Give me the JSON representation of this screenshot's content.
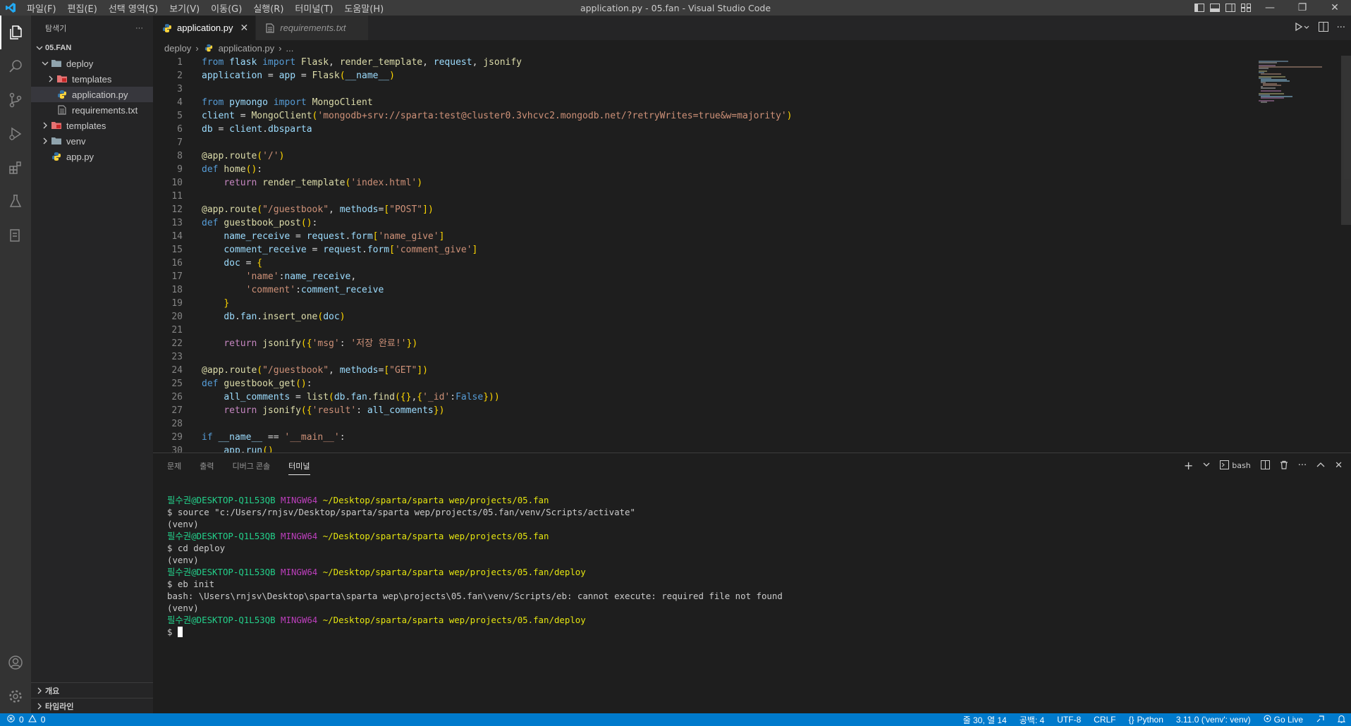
{
  "window": {
    "title": "application.py - 05.fan - Visual Studio Code",
    "menu": [
      "파일(F)",
      "편집(E)",
      "선택 영역(S)",
      "보기(V)",
      "이동(G)",
      "실행(R)",
      "터미널(T)",
      "도움말(H)"
    ]
  },
  "sidebar": {
    "header": "탐색기",
    "more": "···",
    "root": "05.FAN",
    "items": [
      {
        "label": "deploy",
        "type": "folder-open",
        "depth": 1
      },
      {
        "label": "templates",
        "type": "folder",
        "depth": 2
      },
      {
        "label": "application.py",
        "type": "python",
        "depth": 2
      },
      {
        "label": "requirements.txt",
        "type": "text",
        "depth": 2
      },
      {
        "label": "templates",
        "type": "folder",
        "depth": 1
      },
      {
        "label": "venv",
        "type": "folder",
        "depth": 1
      },
      {
        "label": "app.py",
        "type": "python",
        "depth": 1
      }
    ],
    "outline": "개요",
    "timeline": "타임라인"
  },
  "editor": {
    "tabs": [
      {
        "label": "application.py",
        "active": true
      },
      {
        "label": "requirements.txt",
        "active": false
      }
    ],
    "breadcrumb": [
      "deploy",
      "application.py",
      "..."
    ],
    "code_lines": [
      "from flask import Flask, render_template, request, jsonify",
      "application = app = Flask(__name__)",
      "",
      "from pymongo import MongoClient",
      "client = MongoClient('mongodb+srv://sparta:test@cluster0.3vhcvc2.mongodb.net/?retryWrites=true&w=majority')",
      "db = client.dbsparta",
      "",
      "@app.route('/')",
      "def home():",
      "    return render_template('index.html')",
      "",
      "@app.route(\"/guestbook\", methods=[\"POST\"])",
      "def guestbook_post():",
      "    name_receive = request.form['name_give']",
      "    comment_receive = request.form['comment_give']",
      "    doc = {",
      "        'name':name_receive,",
      "        'comment':comment_receive",
      "    }",
      "    db.fan.insert_one(doc)",
      "",
      "    return jsonify({'msg': '저장 완료!'})",
      "",
      "@app.route(\"/guestbook\", methods=[\"GET\"])",
      "def guestbook_get():",
      "    all_comments = list(db.fan.find({},{'_id':False}))",
      "    return jsonify({'result': all_comments})",
      "",
      "if __name__ == '__main__':",
      "    app.run()"
    ]
  },
  "panel": {
    "tabs": [
      "문제",
      "출력",
      "디버그 콘솔",
      "터미널"
    ],
    "active_tab": "터미널",
    "shell": "bash",
    "terminal": [
      {
        "kind": "prompt",
        "user": "필수권@DESKTOP-Q1L53QB",
        "host": "MINGW64",
        "path": "~/Desktop/sparta/sparta wep/projects/05.fan"
      },
      {
        "kind": "text",
        "text": "$ source \"c:/Users/rnjsv/Desktop/sparta/sparta wep/projects/05.fan/venv/Scripts/activate\""
      },
      {
        "kind": "text",
        "text": "(venv)"
      },
      {
        "kind": "prompt",
        "user": "필수권@DESKTOP-Q1L53QB",
        "host": "MINGW64",
        "path": "~/Desktop/sparta/sparta wep/projects/05.fan"
      },
      {
        "kind": "text",
        "text": "$ cd deploy"
      },
      {
        "kind": "text",
        "text": "(venv)"
      },
      {
        "kind": "prompt",
        "user": "필수권@DESKTOP-Q1L53QB",
        "host": "MINGW64",
        "path": "~/Desktop/sparta/sparta wep/projects/05.fan/deploy"
      },
      {
        "kind": "text",
        "text": "$ eb init"
      },
      {
        "kind": "text",
        "text": "bash: \\Users\\rnjsv\\Desktop\\sparta\\sparta wep\\projects\\05.fan\\venv/Scripts/eb: cannot execute: required file not found"
      },
      {
        "kind": "text",
        "text": "(venv)"
      },
      {
        "kind": "prompt",
        "user": "필수권@DESKTOP-Q1L53QB",
        "host": "MINGW64",
        "path": "~/Desktop/sparta/sparta wep/projects/05.fan/deploy"
      },
      {
        "kind": "cursor",
        "text": "$ "
      }
    ]
  },
  "statusbar": {
    "errors": "0",
    "warnings": "0",
    "position": "줄 30, 열 14",
    "spaces": "공백: 4",
    "encoding": "UTF-8",
    "eol": "CRLF",
    "language": "Python",
    "interpreter": "3.11.0 ('venv': venv)",
    "golive": "Go Live"
  },
  "colors": {
    "accent": "#007acc",
    "keyword": "#569cd6",
    "control": "#c586c0",
    "function": "#dcdcaa",
    "string": "#ce9178",
    "variable": "#9cdcfe",
    "class": "#4ec9b0"
  }
}
